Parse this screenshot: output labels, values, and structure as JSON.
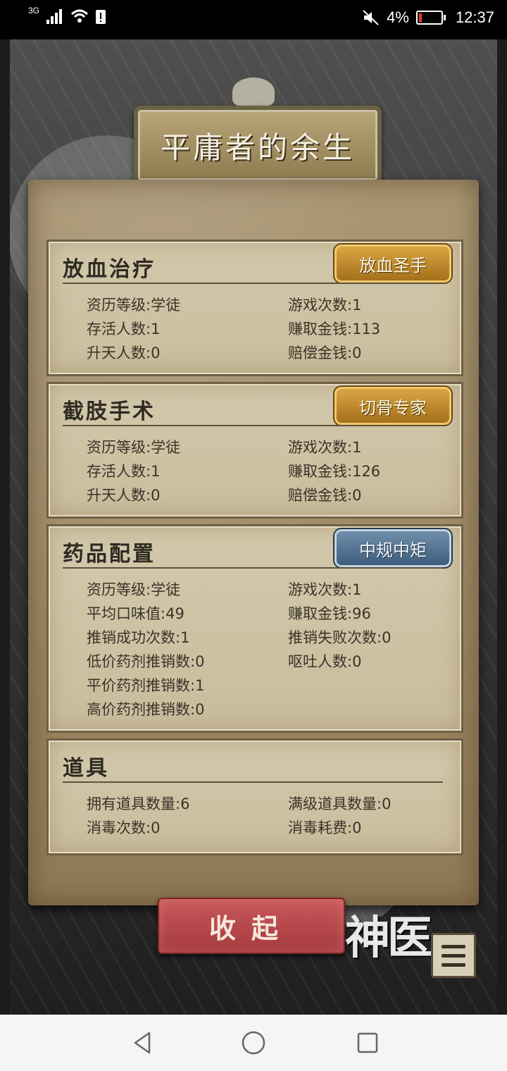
{
  "status_bar": {
    "network": "3G",
    "battery_percent": "4%",
    "time": "12:37"
  },
  "title": "平庸者的余生",
  "sections": [
    {
      "title": "放血治疗",
      "badge": "放血圣手",
      "badge_color": "gold",
      "stats": [
        {
          "label": "资历等级",
          "value": "学徒"
        },
        {
          "label": "游戏次数",
          "value": "1"
        },
        {
          "label": "存活人数",
          "value": "1"
        },
        {
          "label": "赚取金钱",
          "value": "113"
        },
        {
          "label": "升天人数",
          "value": "0"
        },
        {
          "label": "赔偿金钱",
          "value": "0"
        }
      ]
    },
    {
      "title": "截肢手术",
      "badge": "切骨专家",
      "badge_color": "gold",
      "stats": [
        {
          "label": "资历等级",
          "value": "学徒"
        },
        {
          "label": "游戏次数",
          "value": "1"
        },
        {
          "label": "存活人数",
          "value": "1"
        },
        {
          "label": "赚取金钱",
          "value": "126"
        },
        {
          "label": "升天人数",
          "value": "0"
        },
        {
          "label": "赔偿金钱",
          "value": "0"
        }
      ]
    },
    {
      "title": "药品配置",
      "badge": "中规中矩",
      "badge_color": "blue",
      "stats": [
        {
          "label": "资历等级",
          "value": "学徒"
        },
        {
          "label": "游戏次数",
          "value": "1"
        },
        {
          "label": "平均口味值",
          "value": "49"
        },
        {
          "label": "赚取金钱",
          "value": "96"
        },
        {
          "label": "推销成功次数",
          "value": "1"
        },
        {
          "label": "推销失败次数",
          "value": "0"
        },
        {
          "label": "低价药剂推销数",
          "value": "0"
        },
        {
          "label": "呕吐人数",
          "value": "0"
        },
        {
          "label": "平价药剂推销数",
          "value": "1"
        },
        {
          "label": "高价药剂推销数",
          "value": "0"
        }
      ]
    },
    {
      "title": "道具",
      "stats": [
        {
          "label": "拥有道具数量",
          "value": "6"
        },
        {
          "label": "满级道具数量",
          "value": "0"
        },
        {
          "label": "消毒次数",
          "value": "0"
        },
        {
          "label": "消毒耗费",
          "value": "0"
        }
      ]
    }
  ],
  "collapse_label": "收起",
  "logo_text": "神医"
}
